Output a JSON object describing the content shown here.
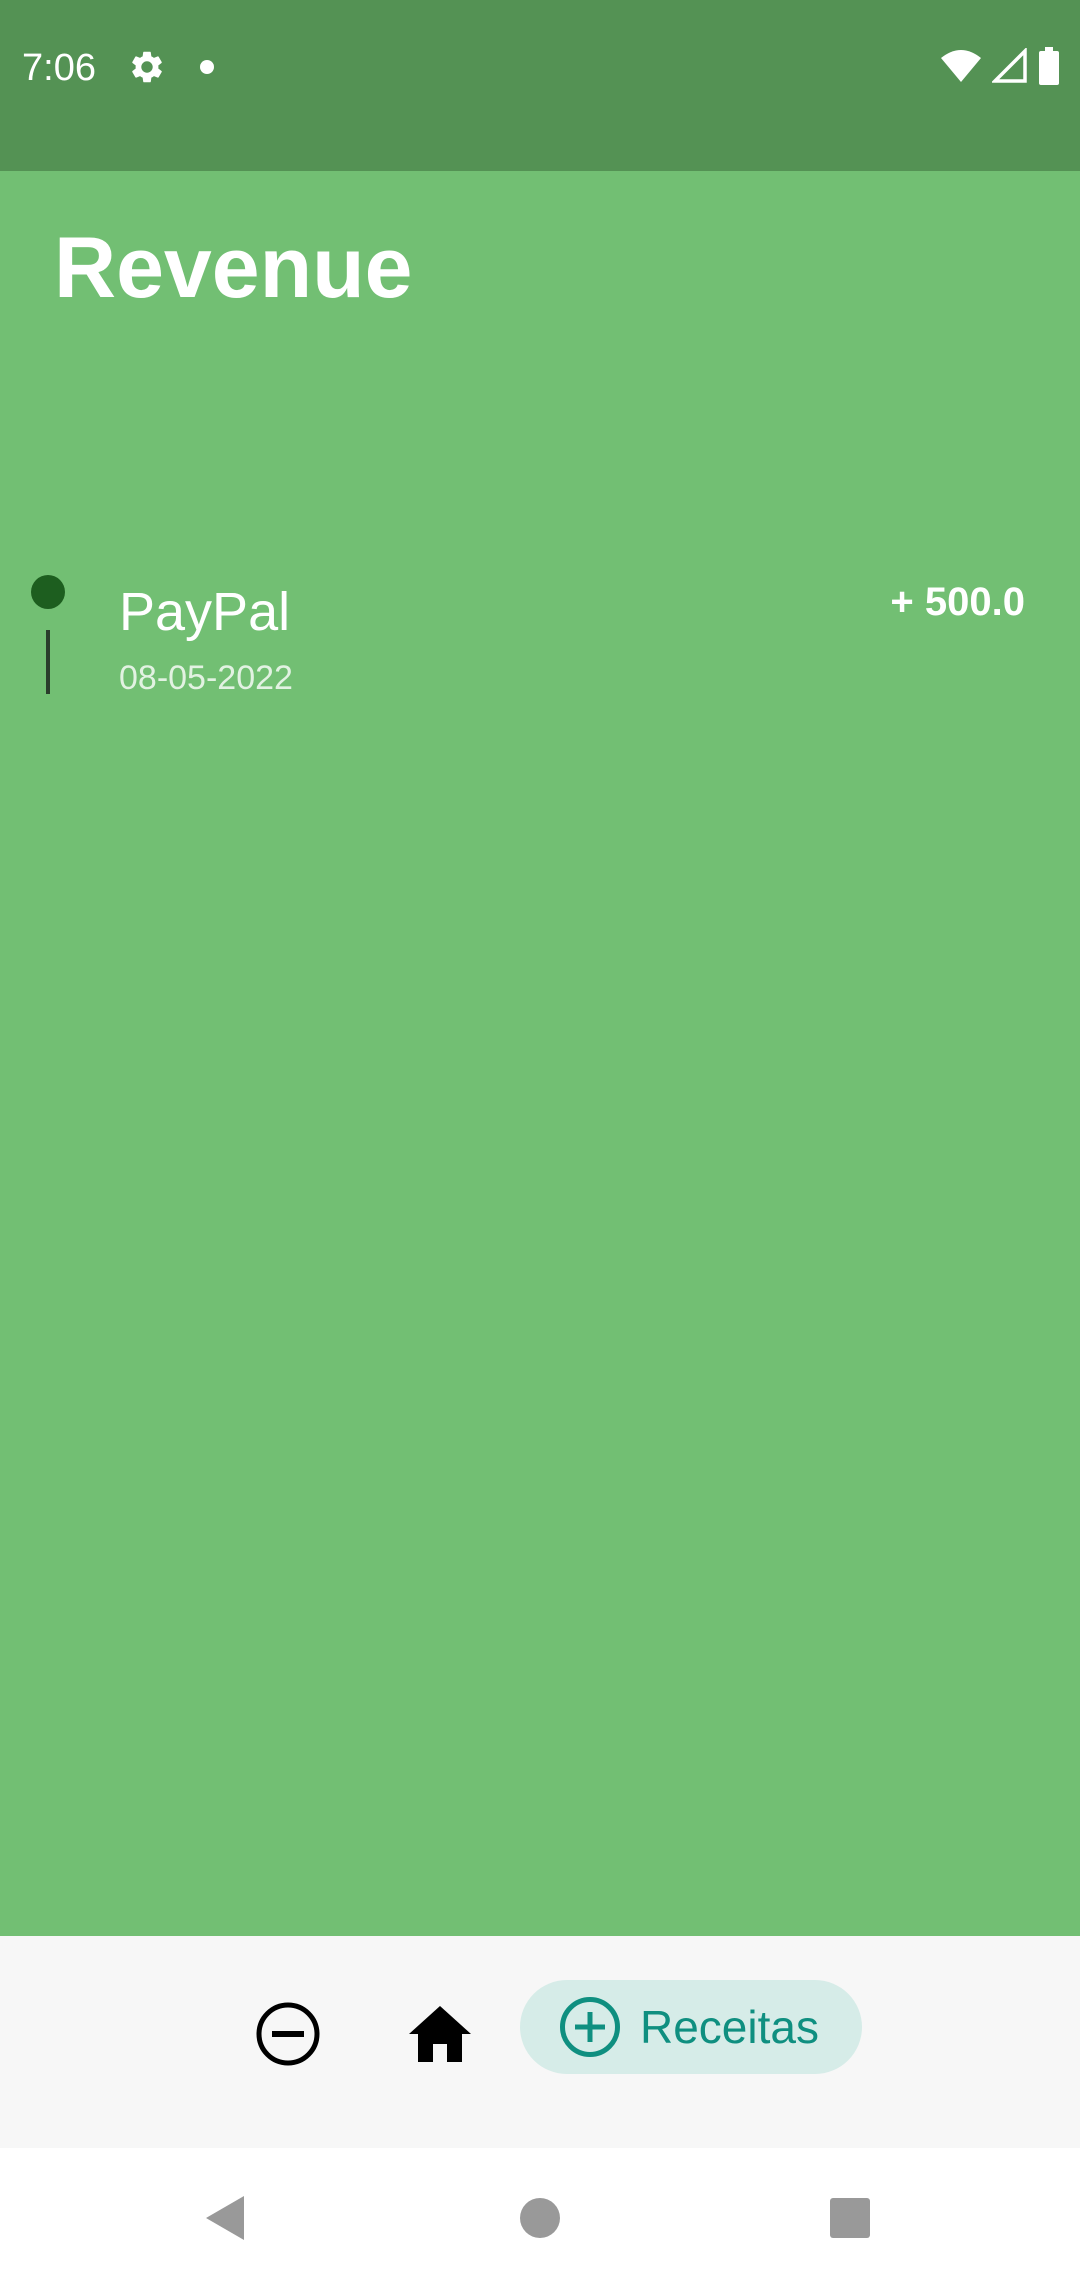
{
  "status_bar": {
    "time": "7:06",
    "icons": [
      "settings-gear-icon",
      "notification-dot-icon",
      "wifi-icon",
      "cell-signal-icon",
      "battery-icon"
    ]
  },
  "page": {
    "title": "Revenue"
  },
  "transactions": [
    {
      "title": "PayPal",
      "date": "08-05-2022",
      "amount": "+ 500.0"
    }
  ],
  "bottom_nav": {
    "items": [
      {
        "icon": "minus-circle-icon",
        "label": "",
        "selected": false
      },
      {
        "icon": "home-icon",
        "label": "",
        "selected": false
      },
      {
        "icon": "plus-circle-icon",
        "label": "Receitas",
        "selected": true
      }
    ]
  },
  "system_nav": {
    "icons": [
      "back-triangle-icon",
      "home-circle-icon",
      "recents-square-icon"
    ]
  },
  "colors": {
    "status_bar": "#549254",
    "background": "#72bf73",
    "timeline_dot": "#1d5e1f",
    "nav_background": "#f7f7f7",
    "nav_selected_pill": "#d6ece8",
    "nav_selected_accent": "#0f8f80"
  }
}
